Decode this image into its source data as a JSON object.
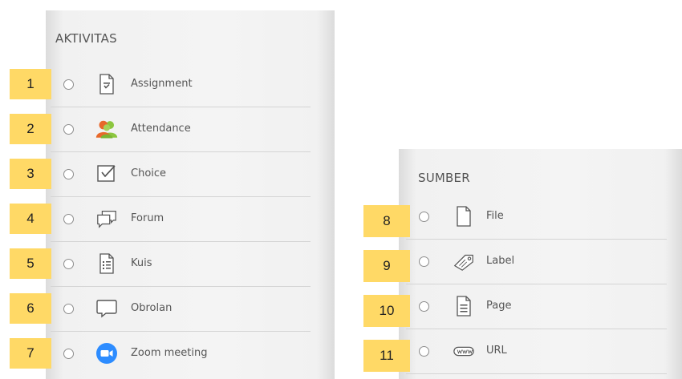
{
  "activities": {
    "title": "AKTIVITAS",
    "items": [
      {
        "label": "Assignment",
        "number": "1",
        "icon": "assignment-icon"
      },
      {
        "label": "Attendance",
        "number": "2",
        "icon": "attendance-icon"
      },
      {
        "label": "Choice",
        "number": "3",
        "icon": "choice-icon"
      },
      {
        "label": "Forum",
        "number": "4",
        "icon": "forum-icon"
      },
      {
        "label": "Kuis",
        "number": "5",
        "icon": "quiz-icon"
      },
      {
        "label": "Obrolan",
        "number": "6",
        "icon": "chat-icon"
      },
      {
        "label": "Zoom meeting",
        "number": "7",
        "icon": "zoom-icon"
      }
    ]
  },
  "resources": {
    "title": "SUMBER",
    "items": [
      {
        "label": "File",
        "number": "8",
        "icon": "file-icon"
      },
      {
        "label": "Label",
        "number": "9",
        "icon": "label-tag-icon"
      },
      {
        "label": "Page",
        "number": "10",
        "icon": "page-icon"
      },
      {
        "label": "URL",
        "number": "11",
        "icon": "url-icon"
      }
    ]
  },
  "colors": {
    "badge": "#ffd966",
    "zoom_blue": "#2d8cff",
    "attendance_green": "#8cc63f",
    "attendance_orange": "#e8692b"
  }
}
